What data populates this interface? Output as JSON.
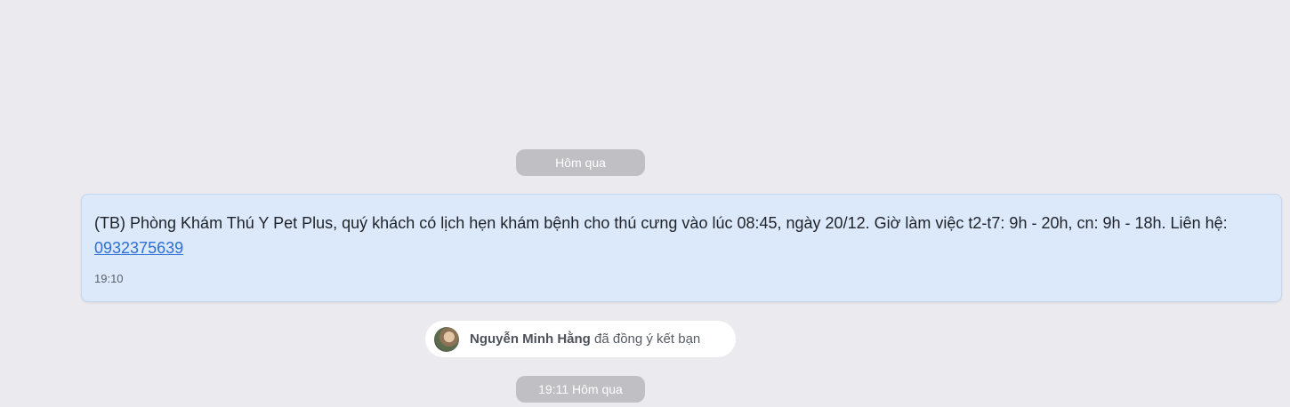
{
  "separators": {
    "yesterday": "Hôm qua",
    "yesterday_with_time": "19:11 Hôm qua"
  },
  "message": {
    "text": "(TB) Phòng Khám Thú Y Pet Plus, quý khách có lịch hẹn khám bệnh cho thú cưng vào lúc 08:45, ngày 20/12. Giờ làm việc t2-t7: 9h  - 20h, cn: 9h - 18h. Liên hệ:",
    "phone_link": "0932375639",
    "time": "19:10"
  },
  "friend_notice": {
    "name": "Nguyễn Minh Hằng",
    "action": "đã đồng ý kết bạn"
  },
  "colors": {
    "background": "#ebeaef",
    "bubble": "#dbe9fb",
    "link": "#2e6fd8",
    "pill": "#bfbfc4"
  }
}
